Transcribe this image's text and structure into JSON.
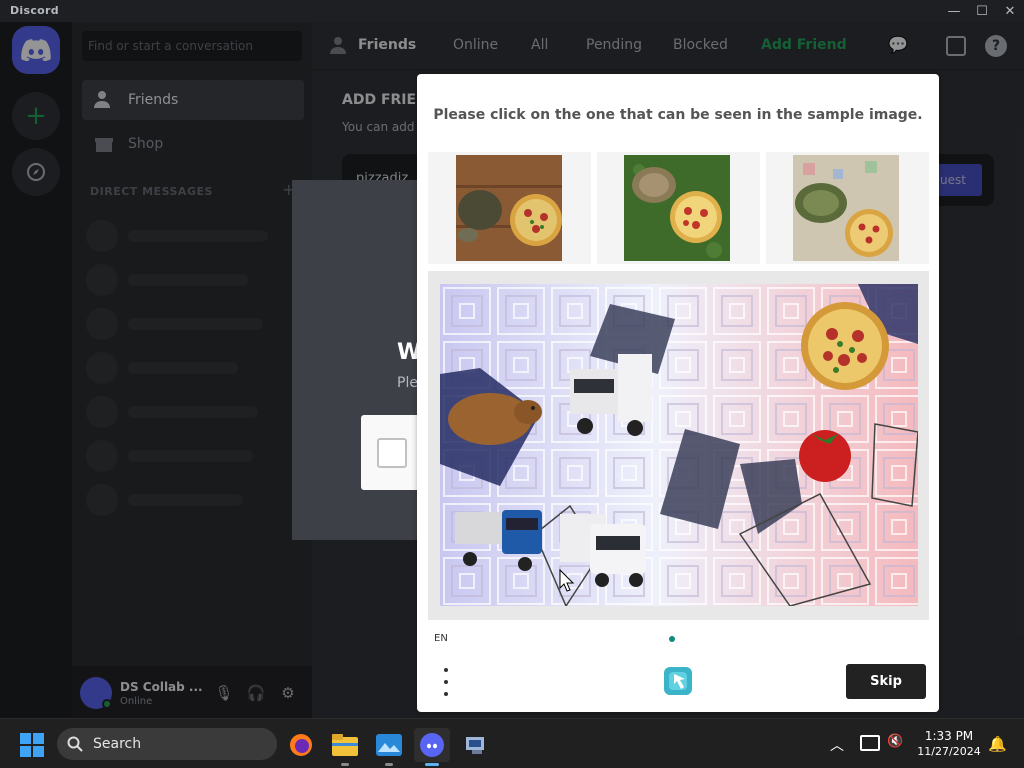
{
  "window": {
    "title": "Discord",
    "controls": [
      "—",
      "☐",
      "✕"
    ]
  },
  "sidebar": {
    "search_placeholder": "Find or start a conversation",
    "items": [
      {
        "label": "Friends",
        "icon": "friends-icon"
      },
      {
        "label": "Shop",
        "icon": "shop-icon"
      }
    ],
    "dm_header": "DIRECT MESSAGES",
    "dm_add": "+"
  },
  "user": {
    "name": "DS Collab ...",
    "status": "Online"
  },
  "header": {
    "title": "Friends",
    "tabs": [
      "Online",
      "All",
      "Pending",
      "Blocked"
    ],
    "add_friend": "Add Friend"
  },
  "add_friend": {
    "title": "ADD FRIEND",
    "description": "You can add",
    "input_value": "pizzadiz",
    "send_label": "uest"
  },
  "verify_modal": {
    "title": "W",
    "subtitle": "Ple"
  },
  "captcha": {
    "prompt": "Please click on the one that can be seen in the sample image.",
    "samples": [
      "tortoise-and-pizza-on-wood",
      "tortoise-and-pizza-on-grass",
      "tortoise-and-pizza-on-tiles"
    ],
    "puzzle_objects": [
      "pizza",
      "capybara",
      "truck",
      "tomato",
      "truck",
      "truck"
    ],
    "language": "EN",
    "skip_label": "Skip",
    "accent": "#0f8a7d"
  },
  "taskbar": {
    "search_label": "Search",
    "time": "1:33 PM",
    "date": "11/27/2024",
    "apps": [
      "firefox-icon",
      "file-explorer-icon",
      "photos-icon",
      "discord-icon",
      "network-app-icon"
    ]
  },
  "colors": {
    "discord_blurple": "#5865f2",
    "discord_green": "#23a55a"
  }
}
